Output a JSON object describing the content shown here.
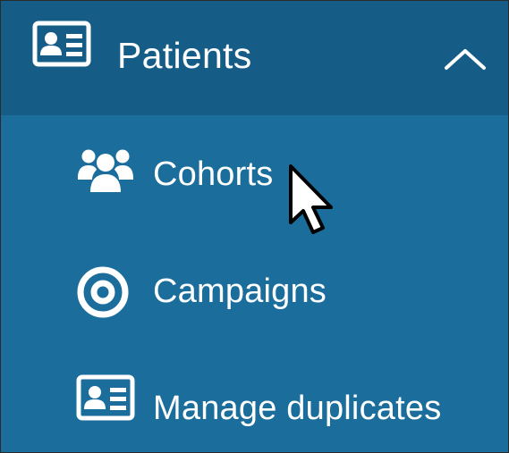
{
  "nav": {
    "section": {
      "title": "Patients",
      "icon": "id-card-icon",
      "toggle_icon": "chevron-up-icon",
      "expanded": true
    },
    "items": [
      {
        "label": "Cohorts",
        "icon": "users-group-icon"
      },
      {
        "label": "Campaigns",
        "icon": "target-icon"
      },
      {
        "label": "Manage duplicates",
        "icon": "id-card-icon"
      }
    ]
  },
  "colors": {
    "header_bg": "#155d86",
    "menu_bg": "#1b6e9c",
    "text": "#ffffff"
  }
}
